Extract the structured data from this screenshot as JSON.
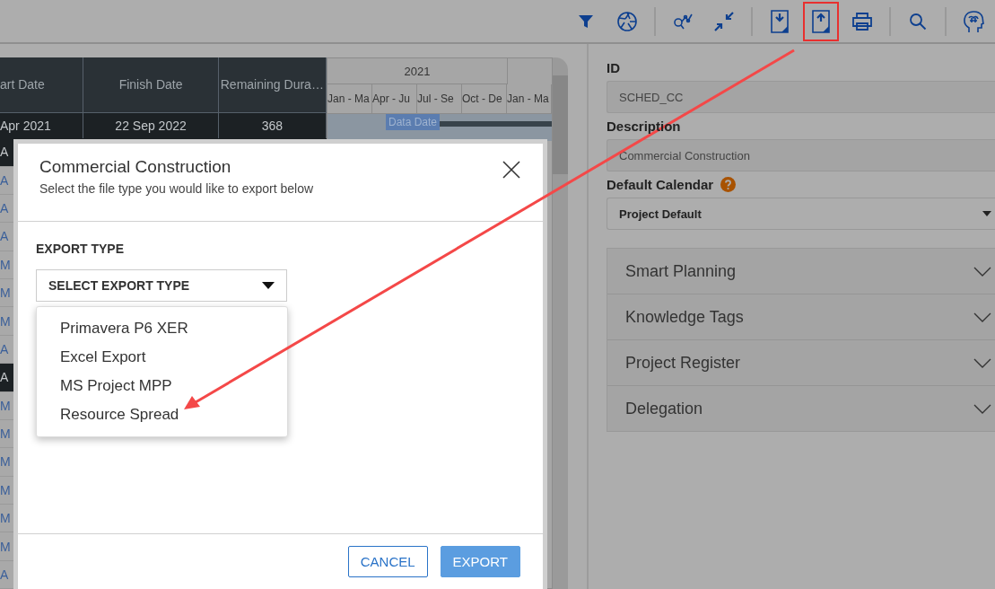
{
  "toolbar": [
    {
      "kind": "filter",
      "highlighted": false
    },
    {
      "kind": "aperture",
      "highlighted": false
    },
    {
      "kind": "divider"
    },
    {
      "kind": "graph",
      "highlighted": false
    },
    {
      "kind": "collapse",
      "highlighted": false
    },
    {
      "kind": "divider"
    },
    {
      "kind": "download",
      "highlighted": false
    },
    {
      "kind": "upload",
      "highlighted": true
    },
    {
      "kind": "print",
      "highlighted": false
    },
    {
      "kind": "divider"
    },
    {
      "kind": "search",
      "highlighted": false
    },
    {
      "kind": "divider"
    },
    {
      "kind": "brain",
      "highlighted": false
    }
  ],
  "table": {
    "columns": [
      "art Date",
      "Finish Date",
      "Remaining Dura…"
    ],
    "first_row": [
      "Apr 2021",
      "22 Sep 2022",
      "368"
    ],
    "row_fragments": [
      {
        "text": "A",
        "kind": "dark"
      },
      {
        "text": "A",
        "kind": "plain"
      },
      {
        "text": "A",
        "kind": "plain"
      },
      {
        "text": "A",
        "kind": "plain"
      },
      {
        "text": "M",
        "kind": "plain"
      },
      {
        "text": "M",
        "kind": "plain"
      },
      {
        "text": "M",
        "kind": "plain"
      },
      {
        "text": "A",
        "kind": "plain"
      },
      {
        "text": "A",
        "kind": "dark"
      },
      {
        "text": "M",
        "kind": "plain"
      },
      {
        "text": "M",
        "kind": "plain"
      },
      {
        "text": "M",
        "kind": "plain"
      },
      {
        "text": "M",
        "kind": "plain"
      },
      {
        "text": "M",
        "kind": "plain"
      },
      {
        "text": "M",
        "kind": "plain"
      },
      {
        "text": "A",
        "kind": "plain"
      }
    ]
  },
  "gantt": {
    "year": "2021",
    "periods": [
      "Jan - Ma",
      "Apr - Ju",
      "Jul - Se",
      "Oct - De",
      "Jan - Ma"
    ],
    "data_date_label": "Data Date"
  },
  "dialog": {
    "title": "Commercial Construction",
    "subtitle": "Select the file type you would like to export below",
    "field_label": "EXPORT TYPE",
    "select_value": "SELECT EXPORT TYPE",
    "options": [
      "Primavera P6 XER",
      "Excel Export",
      "MS Project MPP",
      "Resource Spread"
    ],
    "buttons": [
      {
        "label": "CANCEL",
        "kind": "secondary"
      },
      {
        "label": "EXPORT",
        "kind": "primary"
      }
    ]
  },
  "panel": {
    "fields": [
      {
        "label": "ID",
        "value": "SCHED_CC",
        "kind": "text",
        "help": false
      },
      {
        "label": "Description",
        "value": "Commercial Construction",
        "kind": "text",
        "help": false
      },
      {
        "label": "Default Calendar",
        "value": "Project Default",
        "kind": "select",
        "help": true
      }
    ],
    "sections": [
      {
        "title": "Smart Planning",
        "expanded": false
      },
      {
        "title": "Knowledge Tags",
        "expanded": false
      },
      {
        "title": "Project Register",
        "expanded": false
      },
      {
        "title": "Delegation",
        "expanded": false
      }
    ]
  }
}
